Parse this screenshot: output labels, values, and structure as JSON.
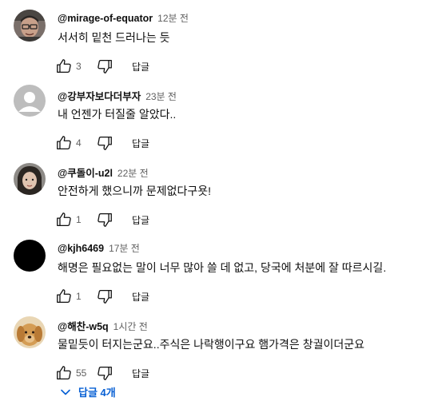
{
  "comments": [
    {
      "author": "@mirage-of-equator",
      "time": "12분 전",
      "text": "서서히 밑천 드러나는 듯",
      "likes": "3",
      "reply_label": "답글",
      "avatar": "photo-person-glasses"
    },
    {
      "author": "@강부자보다더부자",
      "time": "23분 전",
      "text": "내 언젠가 터질줄 알았다..",
      "likes": "4",
      "reply_label": "답글",
      "avatar": "default-user-silhouette"
    },
    {
      "author": "@쿠돌이-u2l",
      "time": "22분 전",
      "text": "안전하게 했으니까 문제없다구욧!",
      "likes": "1",
      "reply_label": "답글",
      "avatar": "photo-person-dark-hair"
    },
    {
      "author": "@kjh6469",
      "time": "17분 전",
      "text": "해명은 필요없는 말이 너무 많아 쓸 데 없고, 당국에 처분에 잘 따르시길.",
      "likes": "1",
      "reply_label": "답글",
      "avatar": "black-circle"
    },
    {
      "author": "@해찬-w5q",
      "time": "1시간 전",
      "text": "물밑듯이 터지는군요..주식은 나락행이구요 햄가격은 창궐이더군요",
      "likes": "55",
      "reply_label": "답글",
      "avatar": "photo-golden-dog"
    }
  ],
  "replies_toggle": {
    "label": "답글 4개",
    "icon": "chevron-down-icon"
  },
  "colors": {
    "link": "#065fd4",
    "secondary_text": "#606060",
    "primary_text": "#0f0f0f"
  }
}
